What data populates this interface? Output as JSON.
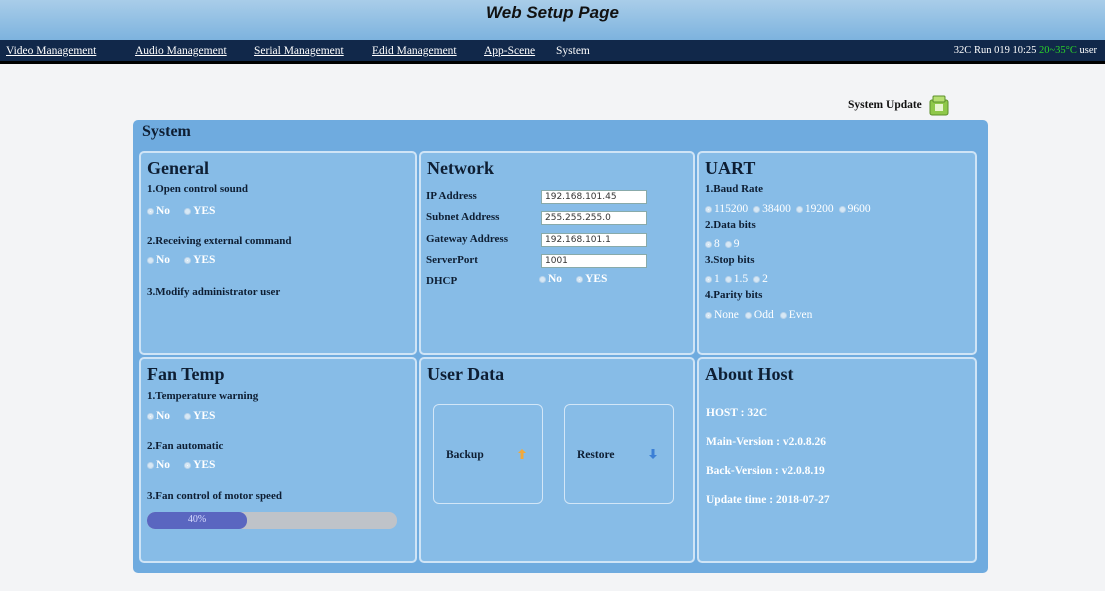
{
  "window_title": "Web Setup Page",
  "nav": {
    "items": [
      "Video Management",
      "Audio Management",
      "Serial Management",
      "Edid Management",
      "App-Scene",
      "System"
    ],
    "status_host": "32C",
    "status_run": "Run 019 10:25",
    "status_temp": "20~35°C",
    "status_user": "user"
  },
  "system_update_label": "System Update",
  "panel_title": "System",
  "general": {
    "heading": "General",
    "item1": "1.Open control sound",
    "item1_options": [
      "No",
      "YES"
    ],
    "item1_selected": "No",
    "item2": "2.Receiving external command",
    "item2_options": [
      "No",
      "YES"
    ],
    "item2_selected": "YES",
    "item3": "3.Modify administrator user"
  },
  "network": {
    "heading": "Network",
    "ip_label": "IP Address",
    "ip_value": "192.168.101.45",
    "subnet_label": "Subnet Address",
    "subnet_value": "255.255.255.0",
    "gateway_label": "Gateway Address",
    "gateway_value": "192.168.101.1",
    "port_label": "ServerPort",
    "port_value": "1001",
    "dhcp_label": "DHCP",
    "dhcp_options": [
      "No",
      "YES"
    ],
    "dhcp_selected": "YES"
  },
  "uart": {
    "heading": "UART",
    "baud_label": "1.Baud Rate",
    "baud_options": [
      "115200",
      "38400",
      "19200",
      "9600"
    ],
    "baud_selected": "115200",
    "data_label": "2.Data bits",
    "data_options": [
      "8",
      "9"
    ],
    "data_selected": "8",
    "stop_label": "3.Stop bits",
    "stop_options": [
      "1",
      "1.5",
      "2"
    ],
    "stop_selected": "1",
    "parity_label": "4.Parity bits",
    "parity_options": [
      "None",
      "Odd",
      "Even"
    ],
    "parity_selected": "None"
  },
  "fan": {
    "heading": "Fan Temp",
    "item1": "1.Temperature warning",
    "item1_options": [
      "No",
      "YES"
    ],
    "item1_selected": "No",
    "item2": "2.Fan automatic",
    "item2_options": [
      "No",
      "YES"
    ],
    "item2_selected": "YES",
    "item3": "3.Fan control of motor speed",
    "speed_text": "40%",
    "speed_fraction": 0.4
  },
  "userdata": {
    "heading": "User Data",
    "backup_label": "Backup",
    "restore_label": "Restore"
  },
  "about": {
    "heading": "About Host",
    "host": "HOST : 32C",
    "main_version": "Main-Version : v2.0.8.26",
    "back_version": "Back-Version : v2.0.8.19",
    "update_time": "Update time : 2018-07-27"
  }
}
